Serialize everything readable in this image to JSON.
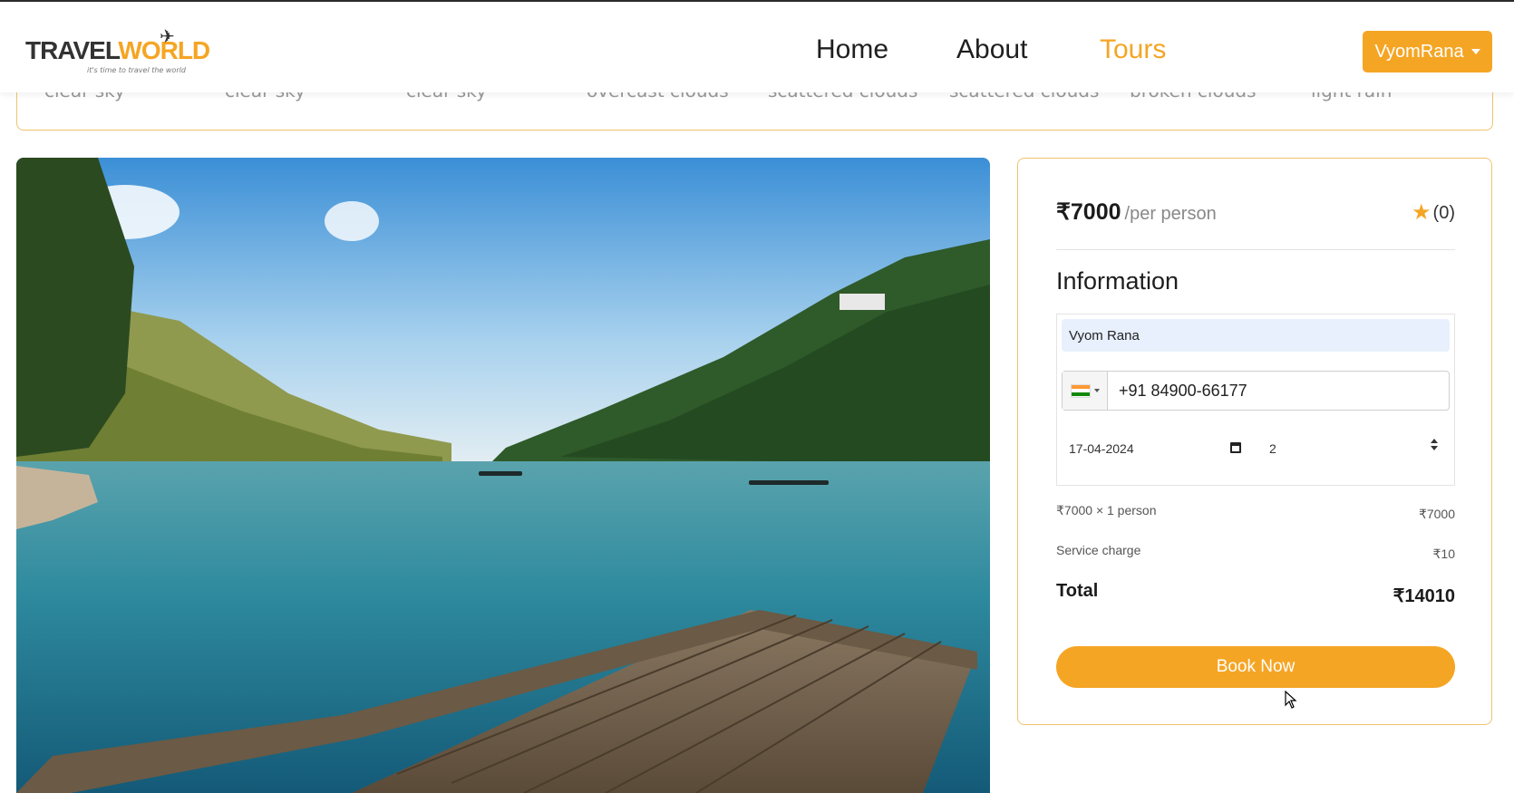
{
  "header": {
    "logo_text_a": "TRAVEL",
    "logo_text_b": "WORLD",
    "logo_tagline": "it's time to travel the world",
    "nav": [
      "Home",
      "About",
      "Tours"
    ],
    "active_nav": "Tours",
    "user_label": "VyomRana"
  },
  "weather": {
    "conditions": [
      "clear sky",
      "clear sky",
      "clear sky",
      "overcast clouds",
      "scattered clouds",
      "scattered clouds",
      "broken clouds",
      "light rain"
    ]
  },
  "booking": {
    "price": "₹7000",
    "per_label": "/per person",
    "rating": "(0)",
    "info_title": "Information",
    "name_value": "Vyom Rana",
    "phone_value": "+91 84900-66177",
    "date_value": "17-04-2024",
    "guests_value": "2",
    "line_label": "₹7000  ×  1 person",
    "line_amount": "₹7000",
    "service_label": "Service charge",
    "service_amount": "₹10",
    "total_label": "Total",
    "total_amount": "₹14010",
    "book_label": "Book Now"
  },
  "colors": {
    "accent": "#f5a524",
    "border": "#f0c36d"
  }
}
